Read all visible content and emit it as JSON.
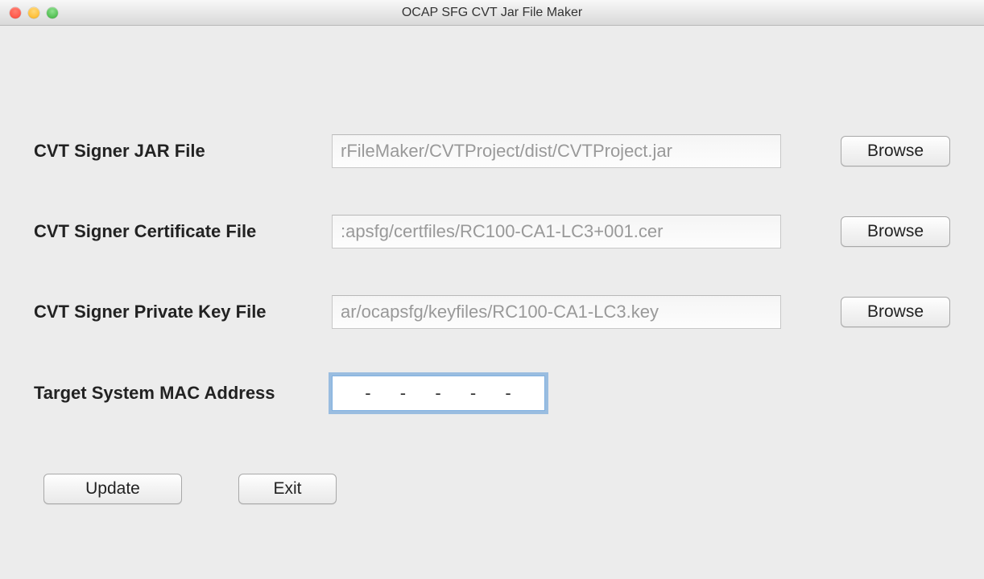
{
  "window": {
    "title": "OCAP SFG CVT Jar File Maker"
  },
  "form": {
    "jarFile": {
      "label": "CVT Signer JAR File",
      "value": "rFileMaker/CVTProject/dist/CVTProject.jar",
      "browse": "Browse"
    },
    "certFile": {
      "label": "CVT Signer Certificate File",
      "value": ":apsfg/certfiles/RC100-CA1-LC3+001.cer",
      "browse": "Browse"
    },
    "keyFile": {
      "label": "CVT Signer Private Key File",
      "value": "ar/ocapsfg/keyfiles/RC100-CA1-LC3.key",
      "browse": "Browse"
    },
    "macAddress": {
      "label": "Target System MAC Address",
      "value": "  -  -  -  -  -"
    }
  },
  "actions": {
    "update": "Update",
    "exit": "Exit"
  }
}
